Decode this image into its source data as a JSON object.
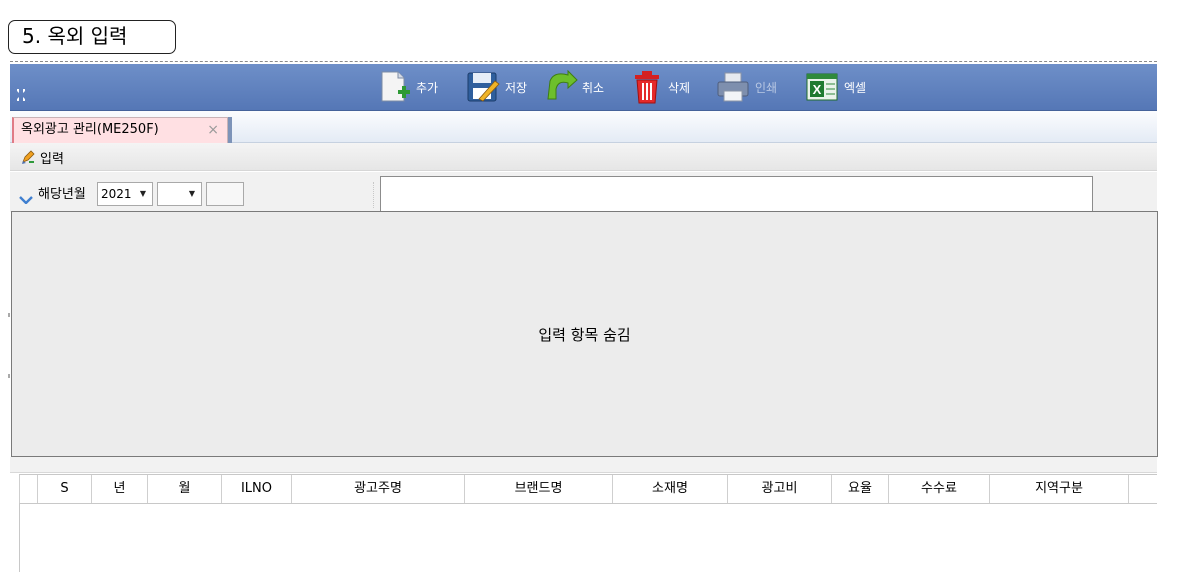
{
  "section_label": "5. 옥외 입력",
  "toolbar": {
    "add_label": "추가",
    "save_label": "저장",
    "cancel_label": "취소",
    "delete_label": "삭제",
    "print_label": "인쇄",
    "excel_label": "엑셀",
    "icons": [
      "collapse-icon",
      "add-document-icon",
      "save-icon",
      "undo-arrow-icon",
      "trash-icon",
      "printer-icon",
      "excel-icon"
    ]
  },
  "tabs": [
    {
      "label": "옥외광고 관리(ME250F)",
      "close": "×"
    }
  ],
  "input_bar": {
    "label": "입력"
  },
  "filter": {
    "label": "해당년월",
    "year_value": "2021",
    "month_value": "",
    "extra_value": ""
  },
  "collapsed_text": "입력 항목 숨김",
  "grid": {
    "columns": [
      "S",
      "년",
      "월",
      "ILNO",
      "광고주명",
      "브랜드명",
      "소재명",
      "광고비",
      "요율",
      "수수료",
      "지역구분"
    ]
  },
  "colors": {
    "toolbar_blue": "#5b7cb9",
    "tab_pink": "#ffe0e3",
    "panel_gray": "#ececec"
  }
}
